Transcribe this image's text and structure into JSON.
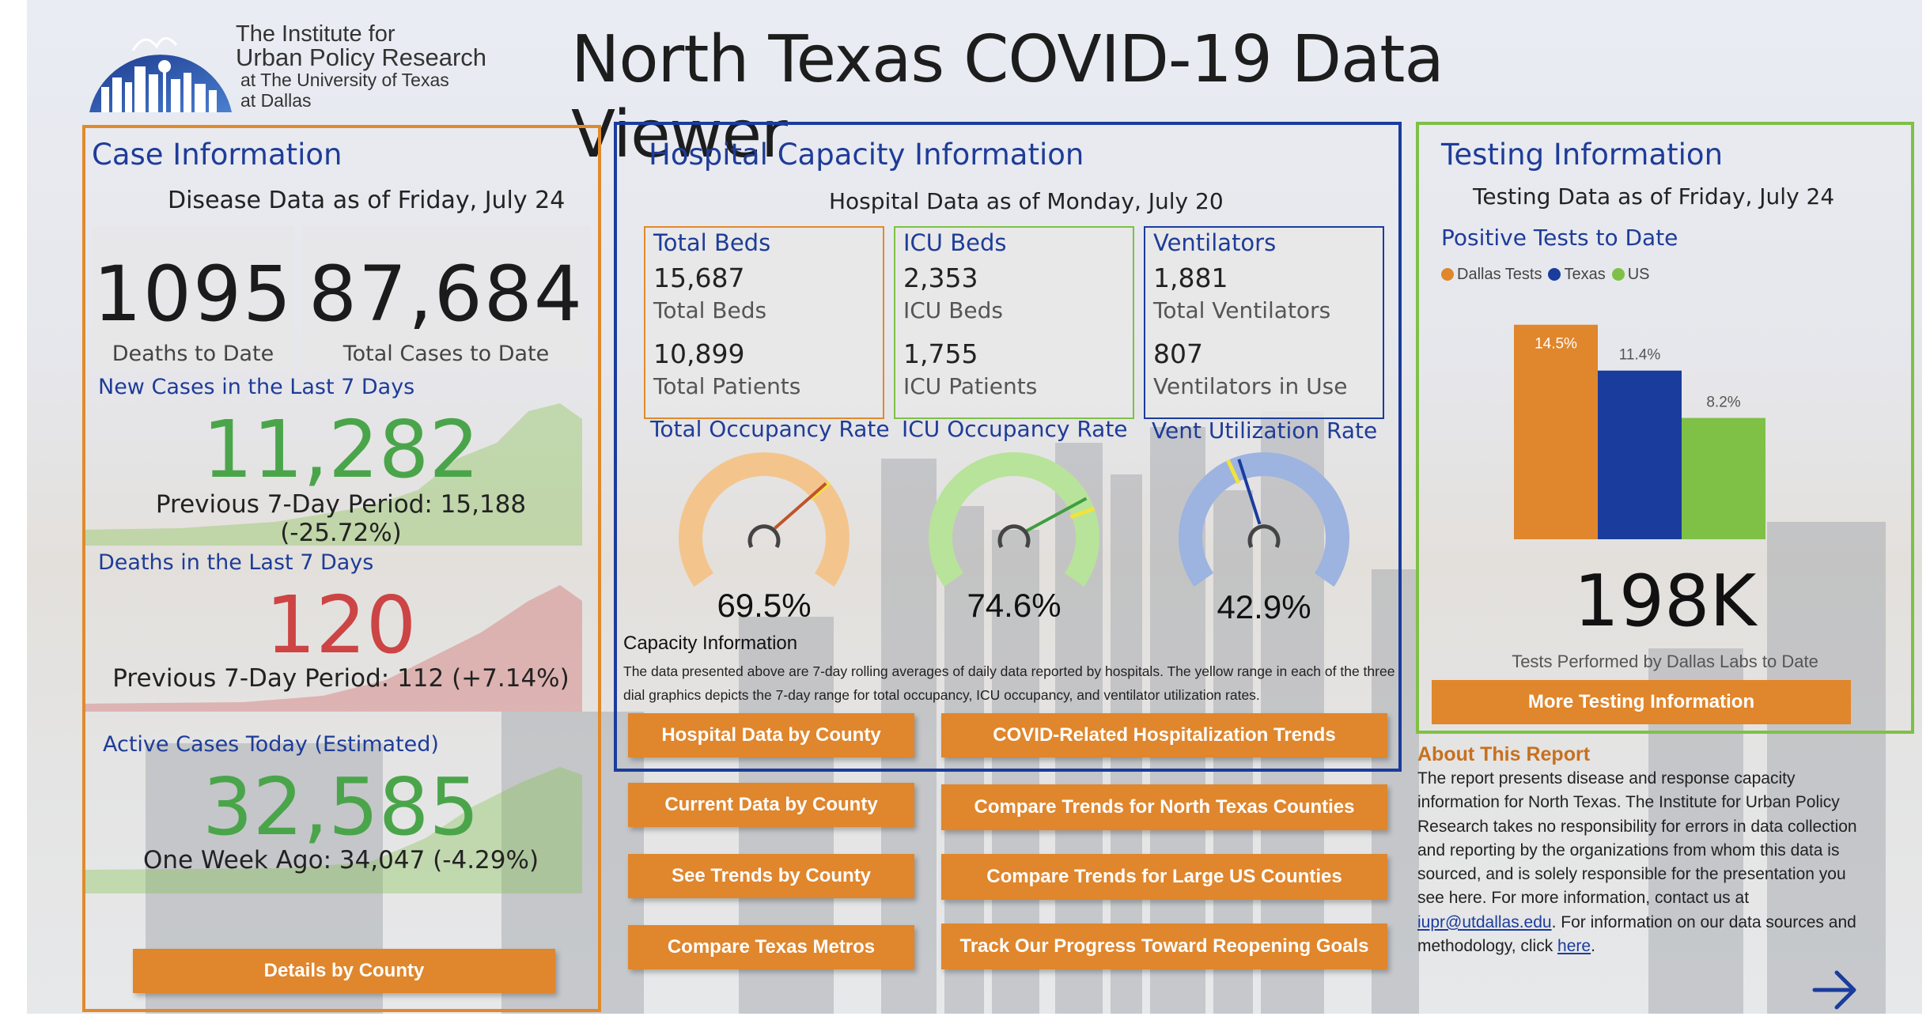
{
  "header": {
    "logo_line1": "The Institute for",
    "logo_line2": "Urban Policy Research",
    "logo_line3": "at The University of Texas",
    "logo_line4": "at Dallas",
    "title": "North Texas COVID-19 Data Viewer"
  },
  "case": {
    "title": "Case Information",
    "as_of": "Disease Data as of Friday, July 24",
    "deaths_value": "1095",
    "deaths_label": "Deaths to Date",
    "cases_value": "87,684",
    "cases_label": "Total Cases to Date",
    "new_cases_title": "New Cases in the Last 7 Days",
    "new_cases_value": "11,282",
    "new_cases_prev": "Previous 7-Day Period: 15,188 (-25.72%)",
    "deaths7_title": "Deaths in the Last 7 Days",
    "deaths7_value": "120",
    "deaths7_prev": "Previous 7-Day Period: 112 (+7.14%)",
    "active_title": "Active Cases Today (Estimated)",
    "active_value": "32,585",
    "active_prev": "One Week Ago: 34,047 (-4.29%)",
    "details_button": "Details by County"
  },
  "hospital": {
    "title": "Hospital Capacity Information",
    "as_of": "Hospital Data as of Monday, July 20",
    "beds": {
      "title": "Total Beds",
      "v1": "15,687",
      "l1": "Total Beds",
      "v2": "10,899",
      "l2": "Total Patients"
    },
    "icu": {
      "title": "ICU Beds",
      "v1": "2,353",
      "l1": "ICU Beds",
      "v2": "1,755",
      "l2": "ICU Patients"
    },
    "vent": {
      "title": "Ventilators",
      "v1": "1,881",
      "l1": "Total Ventilators",
      "v2": "807",
      "l2": "Ventilators in Use"
    },
    "gauges": [
      {
        "title": "Total Occupancy Rate",
        "value": "69.5%",
        "fraction": 0.695,
        "color": "#f3c58d",
        "needle": "#c0532a",
        "yellow_fraction": 0.7
      },
      {
        "title": "ICU Occupancy Rate",
        "value": "74.6%",
        "fraction": 0.746,
        "color": "#b8e39a",
        "needle": "#3f9e3f",
        "yellow_fraction": 0.78
      },
      {
        "title": "Vent Utilization Rate",
        "value": "42.9%",
        "fraction": 0.429,
        "color": "#9db3e0",
        "needle": "#1a3c9c",
        "yellow_fraction": 0.4
      }
    ],
    "note_title": "Capacity Information",
    "note_text": "The data presented above are 7-day rolling averages of daily data reported by hospitals. The yellow range in each of the three dial graphics depicts the 7-day range for total occupancy, ICU occupancy, and ventilator utilization rates."
  },
  "buttons": {
    "hosp_by_county": "Hospital Data by County",
    "hosp_trends": "COVID-Related Hospitalization Trends",
    "current_by_county": "Current Data by County",
    "compare_nt": "Compare Trends for North Texas Counties",
    "see_trends": "See Trends by County",
    "compare_us": "Compare Trends for Large US Counties",
    "compare_metros": "Compare Texas Metros",
    "reopening": "Track Our Progress Toward Reopening Goals",
    "more_testing": "More Testing Information"
  },
  "testing": {
    "title": "Testing Information",
    "as_of": "Testing Data as of Friday, July 24",
    "chart_title": "Positive Tests to Date",
    "tests_value": "198K",
    "tests_label": "Tests Performed by Dallas Labs to Date"
  },
  "chart_data": {
    "type": "bar",
    "title": "Positive Tests to Date",
    "categories": [
      "Dallas Tests",
      "Texas",
      "US"
    ],
    "values": [
      14.5,
      11.4,
      8.2
    ],
    "labels": [
      "14.5%",
      "11.4%",
      "8.2%"
    ],
    "colors": [
      "#e0862c",
      "#1a3c9c",
      "#7fc046"
    ],
    "legend": [
      "Dallas Tests",
      "Texas",
      "US"
    ],
    "legend_position": "top-left",
    "ylim": [
      0,
      15.5
    ]
  },
  "about": {
    "title": "About This Report",
    "text1": "The report presents disease and response capacity information for North Texas. The Institute for Urban Policy Research takes no responsibility for errors in data collection and reporting by the organizations from whom this data is sourced, and is solely responsible for the presentation you see here. For more information, contact us at ",
    "email": "iupr@utdallas.edu",
    "text2": ". For information on our data sources and methodology, click ",
    "here": "here",
    "text3": "."
  },
  "nav": {
    "next_icon": "arrow-right-icon"
  }
}
